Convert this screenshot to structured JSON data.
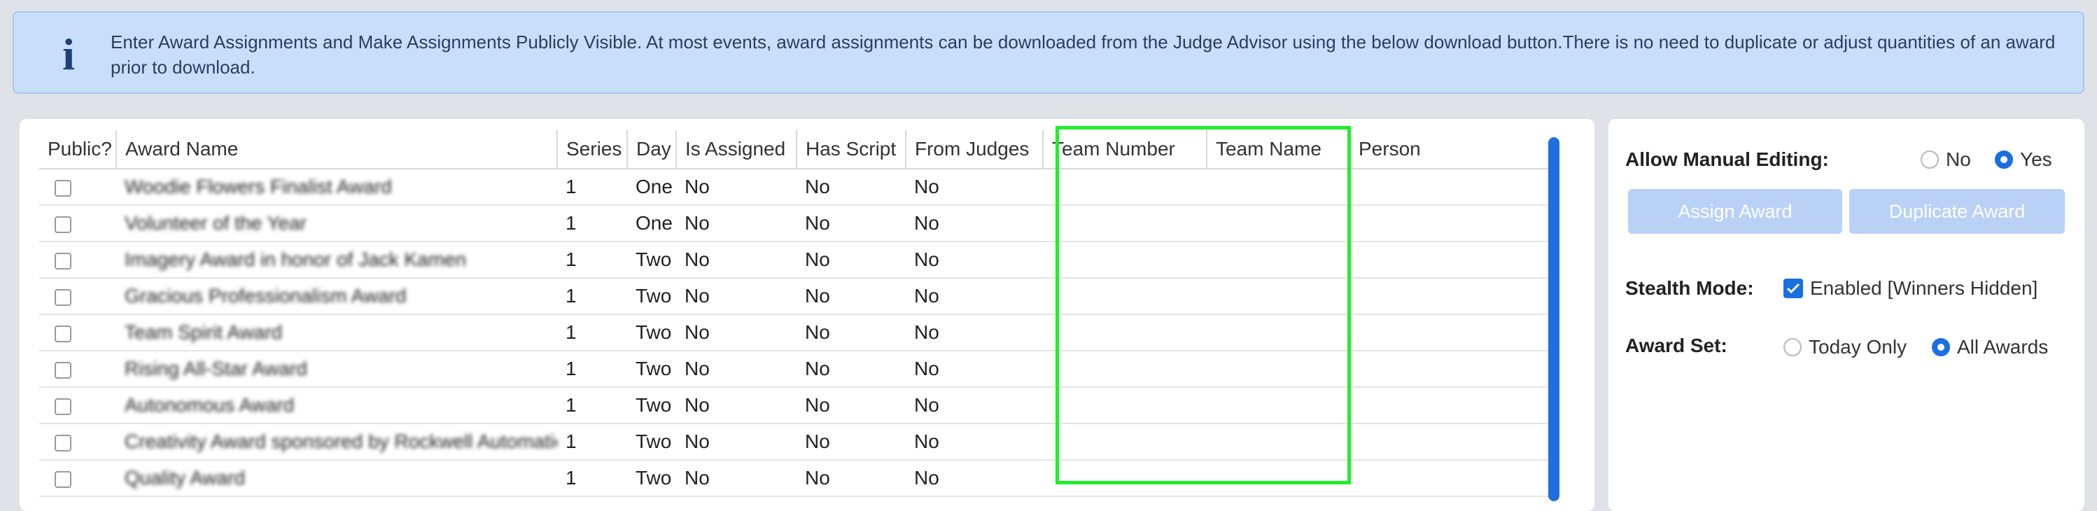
{
  "banner": {
    "icon": "info-icon",
    "icon_glyph": "i",
    "text": "Enter Award Assignments and Make Assignments Publicly Visible. At most events, award assignments can be downloaded from the Judge Advisor using the below download button.There is no need to duplicate or adjust quantities of an award prior to download."
  },
  "table": {
    "headers": [
      "Public?",
      "Award Name",
      "Series",
      "Day",
      "Is Assigned",
      "Has Script",
      "From Judges",
      "Team Number",
      "Team Name",
      "Person"
    ],
    "rows": [
      {
        "award": "Woodie Flowers Finalist Award",
        "series": "1",
        "day": "One",
        "assigned": "No",
        "script": "No",
        "judges": "No"
      },
      {
        "award": "Volunteer of the Year",
        "series": "1",
        "day": "One",
        "assigned": "No",
        "script": "No",
        "judges": "No"
      },
      {
        "award": "Imagery Award in honor of Jack Kamen",
        "series": "1",
        "day": "Two",
        "assigned": "No",
        "script": "No",
        "judges": "No"
      },
      {
        "award": "Gracious Professionalism Award",
        "series": "1",
        "day": "Two",
        "assigned": "No",
        "script": "No",
        "judges": "No"
      },
      {
        "award": "Team Spirit Award",
        "series": "1",
        "day": "Two",
        "assigned": "No",
        "script": "No",
        "judges": "No"
      },
      {
        "award": "Rising All-Star Award",
        "series": "1",
        "day": "Two",
        "assigned": "No",
        "script": "No",
        "judges": "No"
      },
      {
        "award": "Autonomous Award",
        "series": "1",
        "day": "Two",
        "assigned": "No",
        "script": "No",
        "judges": "No"
      },
      {
        "award": "Creativity Award sponsored by Rockwell Automation",
        "series": "1",
        "day": "Two",
        "assigned": "No",
        "script": "No",
        "judges": "No"
      },
      {
        "award": "Quality Award",
        "series": "1",
        "day": "Two",
        "assigned": "No",
        "script": "No",
        "judges": "No"
      }
    ]
  },
  "settings": {
    "manual_editing_label": "Allow Manual Editing:",
    "manual_no": "No",
    "manual_yes": "Yes",
    "assign_award": "Assign Award",
    "duplicate_award": "Duplicate Award",
    "stealth_label": "Stealth Mode:",
    "stealth_value": "Enabled [Winners Hidden]",
    "award_set_label": "Award Set:",
    "award_set_today": "Today Only",
    "award_set_all": "All Awards"
  },
  "colors": {
    "accent": "#1a6fe3",
    "status_no": "#d81b1b",
    "highlight": "#1ff02a",
    "banner_bg": "#c9defa"
  }
}
